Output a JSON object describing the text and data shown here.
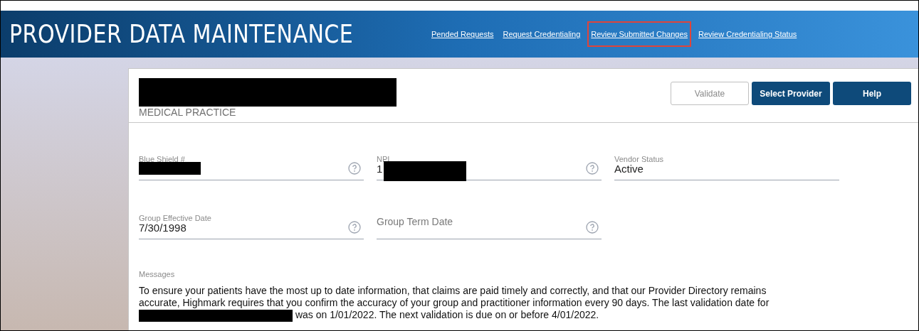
{
  "header": {
    "title": "PROVIDER DATA MAINTENANCE",
    "links": [
      {
        "label": "Pended Requests",
        "highlighted": false
      },
      {
        "label": "Request Credentialing",
        "highlighted": false
      },
      {
        "label": "Review Submitted Changes",
        "highlighted": true
      },
      {
        "label": "Review Credentialing Status",
        "highlighted": false
      }
    ]
  },
  "provider": {
    "subtitle": "MEDICAL PRACTICE",
    "name_redacted": true
  },
  "buttons": [
    {
      "label": "Validate",
      "kind": "outline"
    },
    {
      "label": "Select Provider",
      "kind": "primary"
    },
    {
      "label": "Help",
      "kind": "primary"
    }
  ],
  "fields": [
    [
      {
        "label": "Blue Shield #",
        "redacted": true,
        "help": true
      },
      {
        "label": "NPI",
        "value": "1",
        "redacted": true,
        "help": true
      },
      {
        "label": "Vendor Status",
        "value": "Active"
      }
    ],
    [
      {
        "label": "Group Effective Date",
        "value": "7/30/1998",
        "help": true
      },
      {
        "placeholder": "Group Term Date",
        "help": true
      }
    ]
  ],
  "messages": {
    "label": "Messages",
    "text_before": "To ensure your patients have the most up to date information, that claims are paid timely and correctly, and that our Provider Directory remains accurate, Highmark requires that you confirm the accuracy of your group and practitioner information every 90 days.  The last validation date for",
    "redacted": true,
    "text_after": "was on 1/01/2022.  The next validation is due on or before 4/01/2022."
  }
}
